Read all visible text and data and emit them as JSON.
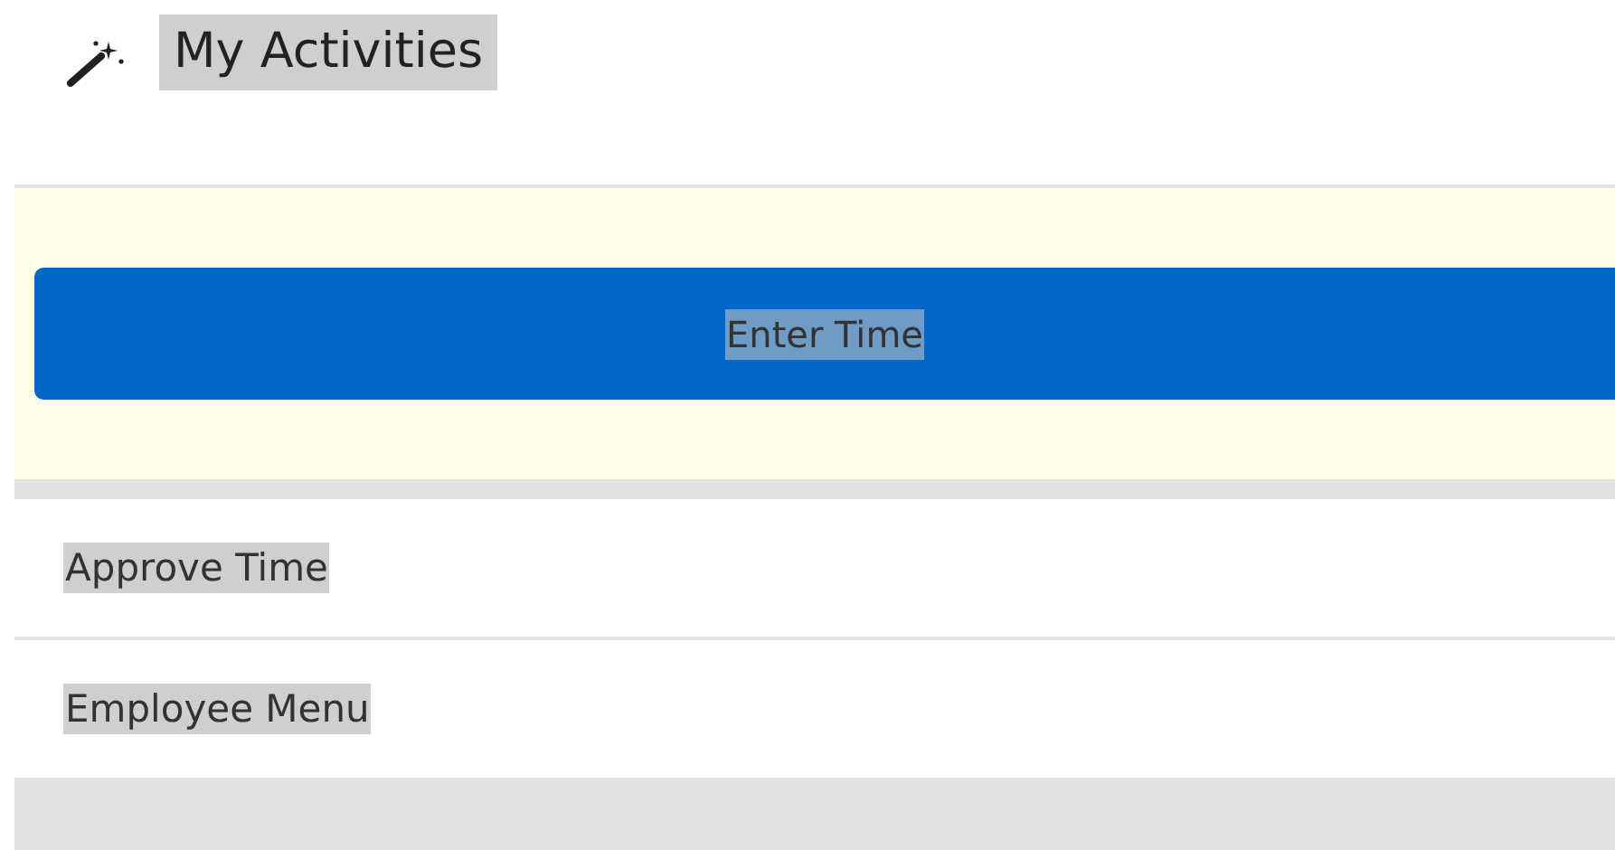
{
  "header": {
    "title": "My Activities"
  },
  "activities": [
    {
      "label": "Enter Time",
      "selected": true
    },
    {
      "label": "Approve Time",
      "selected": false
    },
    {
      "label": "Employee Menu",
      "selected": false
    }
  ]
}
